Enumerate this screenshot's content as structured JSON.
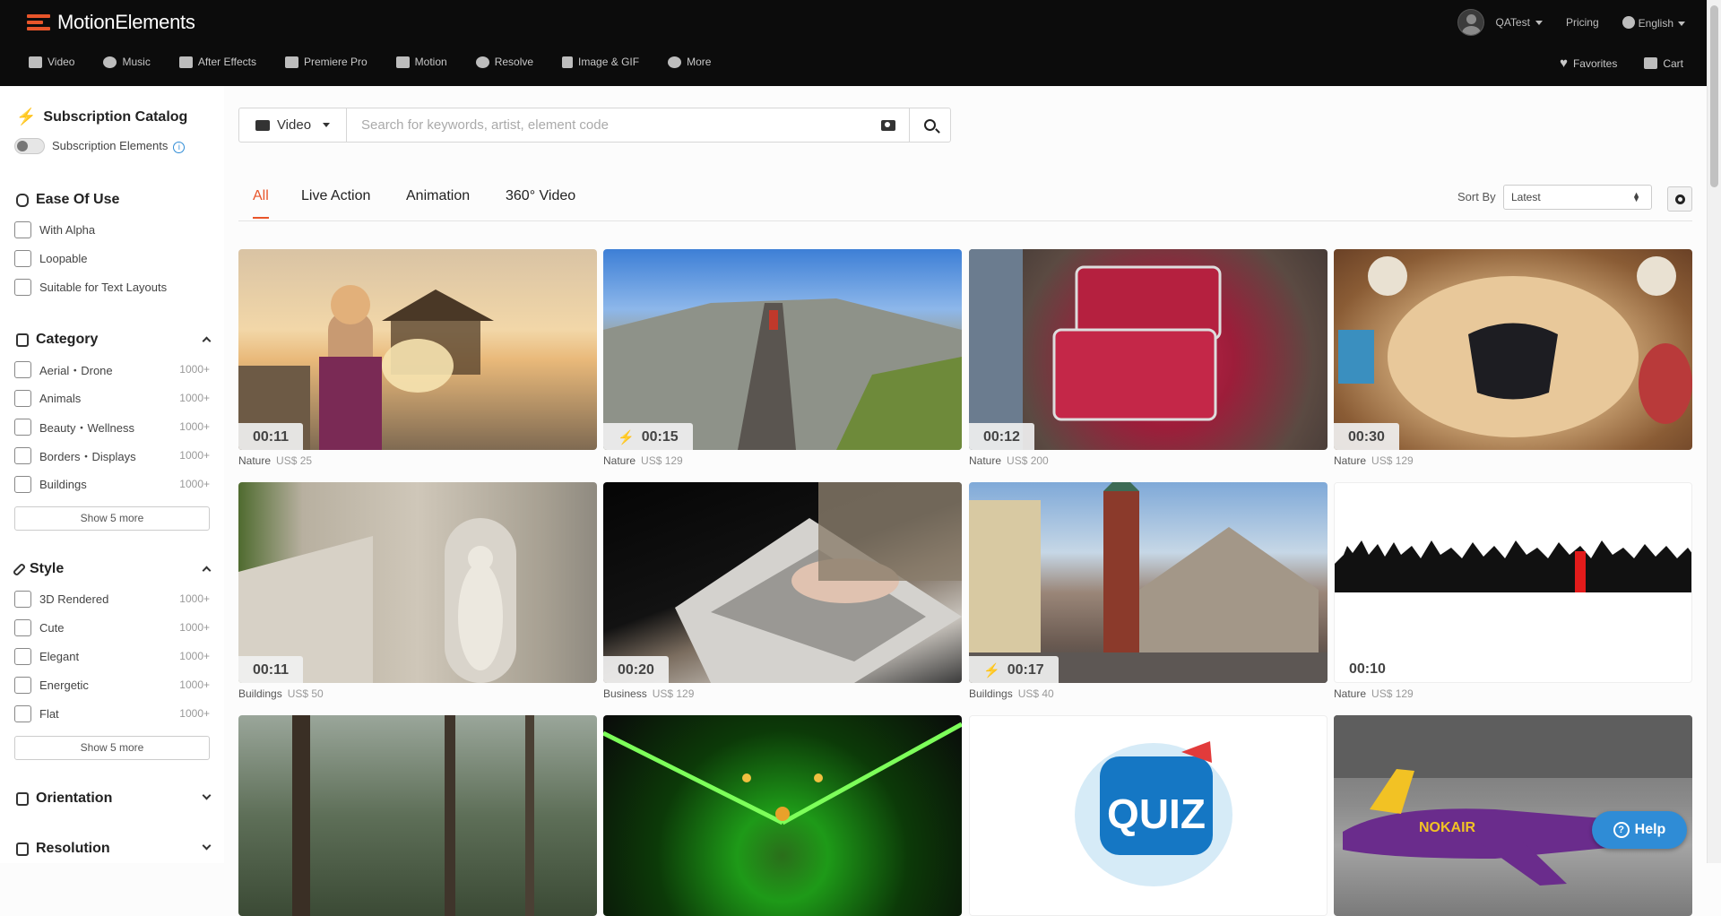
{
  "header": {
    "brand": "MotionElements",
    "user_name": "QATest",
    "pricing": "Pricing",
    "language": "English",
    "nav": [
      {
        "label": "Video",
        "icon": "video-camera-icon"
      },
      {
        "label": "Music",
        "icon": "music-note-icon"
      },
      {
        "label": "After Effects",
        "icon": "after-effects-icon"
      },
      {
        "label": "Premiere Pro",
        "icon": "premiere-pro-icon"
      },
      {
        "label": "Motion",
        "icon": "motion-icon"
      },
      {
        "label": "Resolve",
        "icon": "resolve-icon"
      },
      {
        "label": "Image & GIF",
        "icon": "image-icon"
      },
      {
        "label": "More",
        "icon": "more-chevron-icon"
      }
    ],
    "favorites": "Favorites",
    "cart": "Cart"
  },
  "sidebar": {
    "subscription": {
      "title": "Subscription Catalog",
      "toggle_label": "Subscription Elements",
      "info_icon": "i"
    },
    "ease": {
      "title": "Ease Of Use",
      "items": [
        "With Alpha",
        "Loopable",
        "Suitable for Text Layouts"
      ]
    },
    "category": {
      "title": "Category",
      "items": [
        {
          "label": "Aerial・Drone",
          "count": "1000+"
        },
        {
          "label": "Animals",
          "count": "1000+"
        },
        {
          "label": "Beauty・Wellness",
          "count": "1000+"
        },
        {
          "label": "Borders・Displays",
          "count": "1000+"
        },
        {
          "label": "Buildings",
          "count": "1000+"
        }
      ],
      "show_more": "Show 5 more"
    },
    "style": {
      "title": "Style",
      "items": [
        {
          "label": "3D Rendered",
          "count": "1000+"
        },
        {
          "label": "Cute",
          "count": "1000+"
        },
        {
          "label": "Elegant",
          "count": "1000+"
        },
        {
          "label": "Energetic",
          "count": "1000+"
        },
        {
          "label": "Flat",
          "count": "1000+"
        }
      ],
      "show_more": "Show 5 more"
    },
    "orientation": {
      "title": "Orientation"
    },
    "resolution": {
      "title": "Resolution"
    }
  },
  "search": {
    "type": "Video",
    "placeholder": "Search for keywords, artist, element code"
  },
  "tabs": [
    "All",
    "Live Action",
    "Animation",
    "360° Video"
  ],
  "sort": {
    "label": "Sort By",
    "value": "Latest"
  },
  "results": [
    {
      "duration": "00:11",
      "category": "Nature",
      "price": "US$ 25",
      "subscription": false
    },
    {
      "duration": "00:15",
      "category": "Nature",
      "price": "US$ 129",
      "subscription": true
    },
    {
      "duration": "00:12",
      "category": "Nature",
      "price": "US$ 200",
      "subscription": false
    },
    {
      "duration": "00:30",
      "category": "Nature",
      "price": "US$ 129",
      "subscription": false
    },
    {
      "duration": "00:11",
      "category": "Buildings",
      "price": "US$ 50",
      "subscription": false
    },
    {
      "duration": "00:20",
      "category": "Business",
      "price": "US$ 129",
      "subscription": false
    },
    {
      "duration": "00:17",
      "category": "Buildings",
      "price": "US$ 40",
      "subscription": true
    },
    {
      "duration": "00:10",
      "category": "Nature",
      "price": "US$ 129",
      "subscription": false
    }
  ],
  "quiz_text": "QUIZ",
  "plane_livery": "NOKAIR",
  "help": "Help",
  "colors": {
    "accent": "#e8552a",
    "subscription_blue": "#2f8cd6",
    "header_bg": "#0c0c0c"
  }
}
